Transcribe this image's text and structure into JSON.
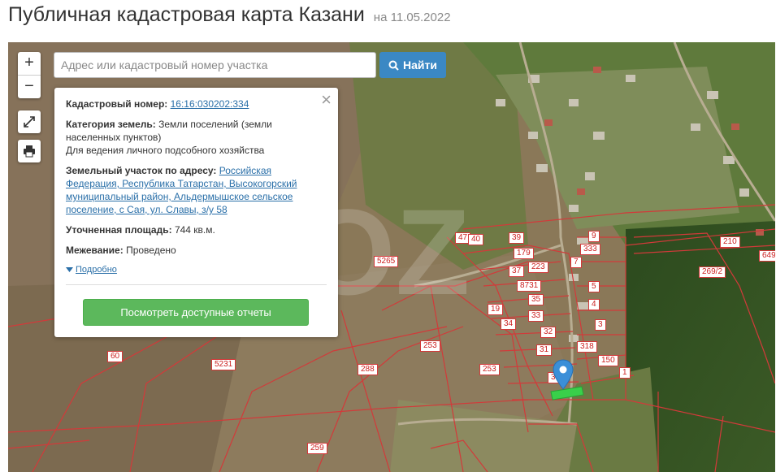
{
  "header": {
    "title": "Публичная кадастровая карта Казани",
    "date": "на 11.05.2022"
  },
  "map_controls": {
    "zoom_in": "+",
    "zoom_out": "−",
    "fullscreen_icon": "expand-icon",
    "print_icon": "print-icon"
  },
  "search": {
    "placeholder": "Адрес или кадастровый номер участка",
    "value": "",
    "button_label": "Найти",
    "button_icon": "search-icon"
  },
  "popup": {
    "cadastral_label": "Кадастровый номер:",
    "cadastral_value": "16:16:030202:334",
    "category_label": "Категория земель:",
    "category_value": "Земли поселений (земли населенных пунктов)",
    "usage_value": "Для ведения личного подсобного хозяйства",
    "address_label": "Земельный участок по адресу:",
    "address_value": "Российская Федерация, Республика Татарстан, Высокогорский муниципальный район, Альдермышское сельское поселение, с Сая, ул. Славы, з/у 58",
    "area_label": "Уточненная площадь:",
    "area_value": "744 кв.м.",
    "survey_label": "Межевание:",
    "survey_value": "Проведено",
    "more_link": "Подробно",
    "reports_button": "Посмотреть доступные отчеты",
    "close": "×"
  },
  "parcel_labels": [
    "39",
    "179",
    "37",
    "223",
    "8731",
    "35",
    "33",
    "32",
    "31",
    "9",
    "333",
    "7",
    "5",
    "4",
    "3",
    "318",
    "150",
    "1",
    "210",
    "269/2",
    "6491",
    "5265",
    "253",
    "253",
    "288",
    "5231",
    "60",
    "259",
    "47",
    "40",
    "19",
    "34",
    "3"
  ],
  "colors": {
    "parcel_border": "#d23a3a",
    "search_button": "#3b88c4",
    "reports_button": "#5cb85c",
    "link": "#2a6fa8",
    "pin": "#3b8fd8",
    "selected_parcel": "#39d04a"
  }
}
